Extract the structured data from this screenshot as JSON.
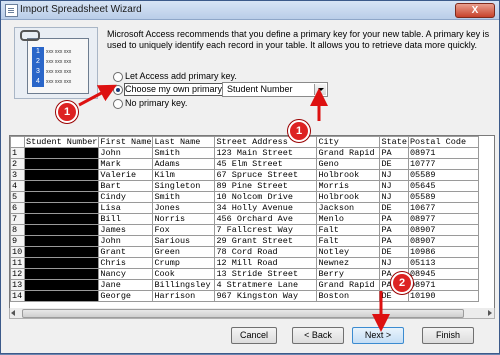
{
  "window": {
    "title": "Import Spreadsheet Wizard",
    "close_label": "X"
  },
  "description": "Microsoft Access recommends that you define a primary key for your new table. A primary key is used to uniquely identify each record in your table. It allows you to retrieve data more quickly.",
  "options": [
    {
      "label": "Let Access add primary key.",
      "checked": false
    },
    {
      "label": "Choose my own primary key.",
      "checked": true
    },
    {
      "label": "No primary key.",
      "checked": false
    }
  ],
  "primary_key_select": {
    "value": "Student Number"
  },
  "graphic": {
    "numbers": [
      "1",
      "2",
      "3",
      "4"
    ],
    "cell_text": "xxx xxx xxx"
  },
  "table": {
    "headers": [
      "Student Number",
      "First Name",
      "Last Name",
      "Street Address",
      "City",
      "State",
      "Postal Code"
    ],
    "rows": [
      [
        "1",
        "",
        "John",
        "Smith",
        "123 Main Street",
        "Grand Rapid",
        "PA",
        "08971"
      ],
      [
        "2",
        "",
        "Mark",
        "Adams",
        "45 Elm Street",
        "Geno",
        "DE",
        "10777"
      ],
      [
        "3",
        "",
        "Valerie",
        "Kilm",
        "67 Spruce Street",
        "Holbrook",
        "NJ",
        "05589"
      ],
      [
        "4",
        "",
        "Bart",
        "Singleton",
        "89 Pine Street",
        "Morris",
        "NJ",
        "05645"
      ],
      [
        "5",
        "",
        "Cindy",
        "Smith",
        "10 Nolcom Drive",
        "Holbrook",
        "NJ",
        "05589"
      ],
      [
        "6",
        "",
        "Lisa",
        "Jones",
        "34 Holly Avenue",
        "Jackson",
        "DE",
        "10677"
      ],
      [
        "7",
        "",
        "Bill",
        "Norris",
        "456 Orchard Ave",
        "Menlo",
        "PA",
        "08977"
      ],
      [
        "8",
        "",
        "James",
        "Fox",
        "7 Fallcrest Way",
        "Falt",
        "PA",
        "08907"
      ],
      [
        "9",
        "",
        "John",
        "Sarious",
        "29 Grant Street",
        "Falt",
        "PA",
        "08907"
      ],
      [
        "10",
        "",
        "Grant",
        "Green",
        "78 Cord Road",
        "Notley",
        "DE",
        "10986"
      ],
      [
        "11",
        "",
        "Chris",
        "Crump",
        "12 Mill Road",
        "Newnez",
        "NJ",
        "05113"
      ],
      [
        "12",
        "",
        "Nancy",
        "Cook",
        "13 Stride Street",
        "Berry",
        "PA",
        "08945"
      ],
      [
        "13",
        "",
        "Jane",
        "Billingsley",
        "4 Stratmere Lane",
        "Grand Rapid",
        "PA",
        "08971"
      ],
      [
        "14",
        "",
        "George",
        "Harrison",
        "967 Kingston Way",
        "Boston",
        "DE",
        "10190"
      ]
    ]
  },
  "buttons": {
    "cancel": "Cancel",
    "back": "< Back",
    "next": "Next >",
    "finish": "Finish"
  },
  "callouts": [
    "1",
    "1",
    "2"
  ],
  "colors": {
    "callout": "#dd1111",
    "key_strip": "#2a66c9",
    "title_bar": "#c9d9ef"
  }
}
